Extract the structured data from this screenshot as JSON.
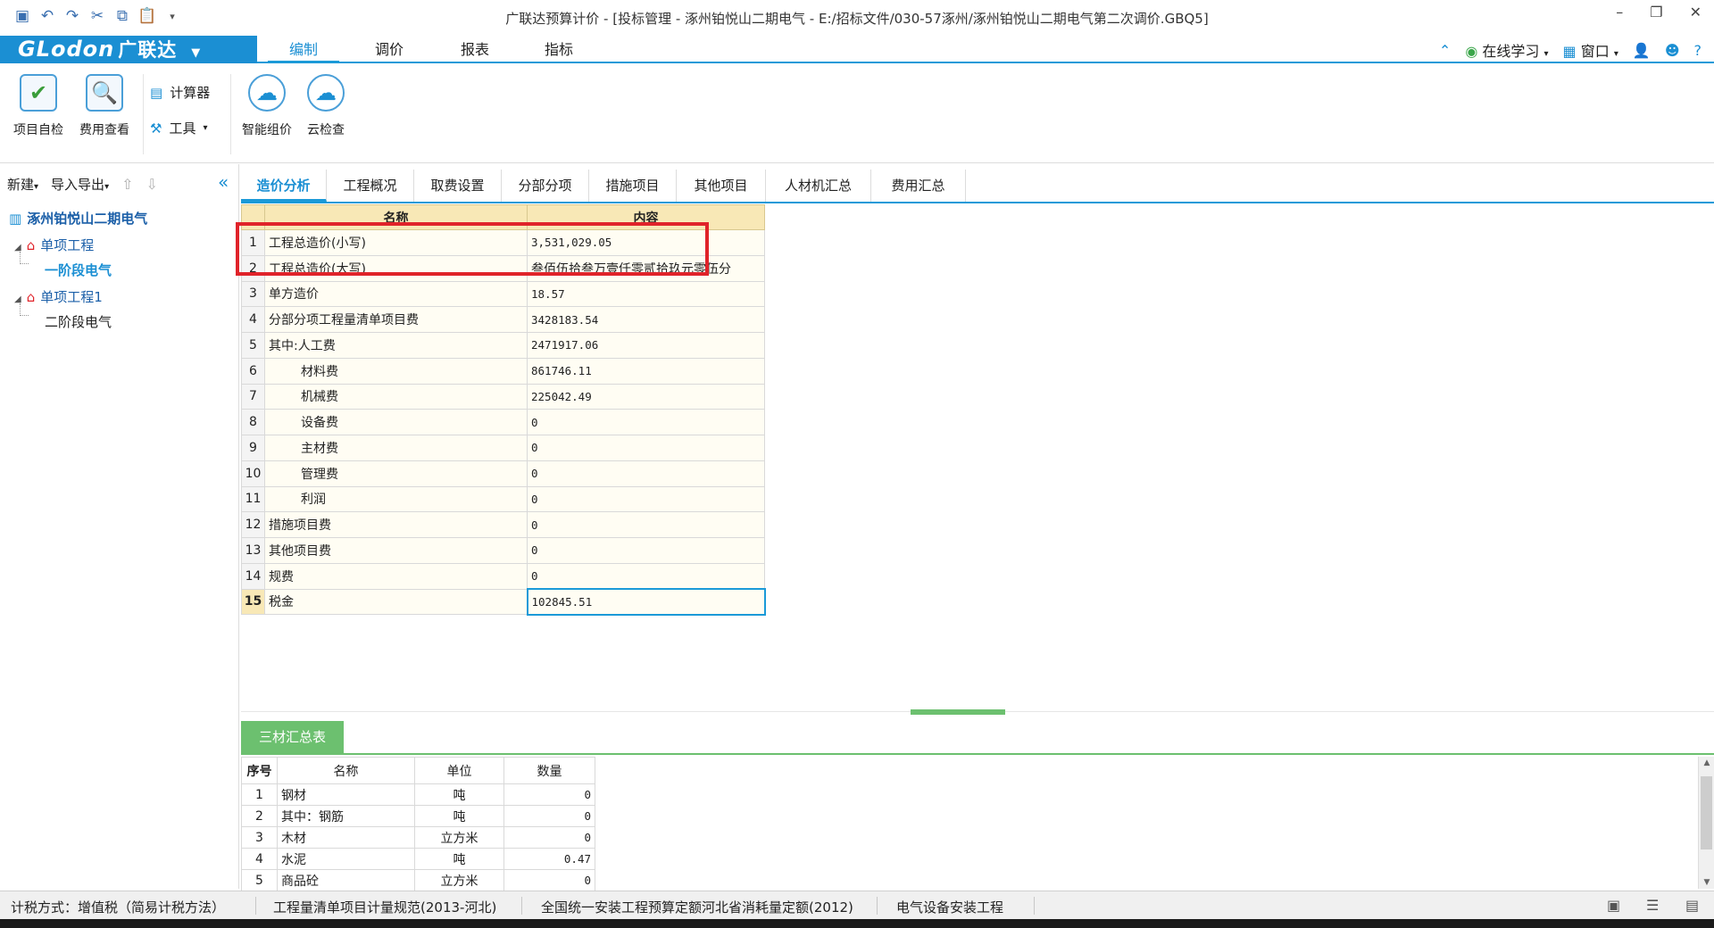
{
  "window": {
    "title": "广联达预算计价 - [投标管理 - 涿州铂悦山二期电气 - E:/招标文件/030-57涿州/涿州铂悦山二期电气第二次调价.GBQ5]"
  },
  "menubar": {
    "logo_text": "GLodon",
    "logo_cn": "广联达",
    "tabs": [
      "编制",
      "调价",
      "报表",
      "指标"
    ],
    "online_learning": "在线学习",
    "window_menu": "窗口",
    "help": "?"
  },
  "ribbon": {
    "project_check": "项目自检",
    "fee_view": "费用查看",
    "calculator": "计算器",
    "tools": "工具",
    "smart_pricing": "智能组价",
    "cloud_check": "云检查"
  },
  "left_panel": {
    "new_label": "新建",
    "import_export_label": "导入导出",
    "project_name": "涿州铂悦山二期电气",
    "tree": [
      {
        "label": "单项工程",
        "children": [
          "一阶段电气"
        ]
      },
      {
        "label": "单项工程1",
        "children": [
          "二阶段电气"
        ]
      }
    ]
  },
  "tabs": [
    "造价分析",
    "工程概况",
    "取费设置",
    "分部分项",
    "措施项目",
    "其他项目",
    "人材机汇总",
    "费用汇总"
  ],
  "cost_table": {
    "headers": [
      "名称",
      "内容"
    ],
    "rows": [
      {
        "no": "1",
        "name": "工程总造价(小写)",
        "value": "3,531,029.05"
      },
      {
        "no": "2",
        "name": "工程总造价(大写)",
        "value": "叁佰伍拾叁万壹仟零贰拾玖元零伍分"
      },
      {
        "no": "3",
        "name": "单方造价",
        "value": "18.57"
      },
      {
        "no": "4",
        "name": "分部分项工程量清单项目费",
        "value": "3428183.54"
      },
      {
        "no": "5",
        "name": "其中:人工费",
        "value": "2471917.06"
      },
      {
        "no": "6",
        "name": "材料费",
        "value": "861746.11"
      },
      {
        "no": "7",
        "name": "机械费",
        "value": "225042.49"
      },
      {
        "no": "8",
        "name": "设备费",
        "value": "0"
      },
      {
        "no": "9",
        "name": "主材费",
        "value": "0"
      },
      {
        "no": "10",
        "name": "管理费",
        "value": "0"
      },
      {
        "no": "11",
        "name": "利润",
        "value": "0"
      },
      {
        "no": "12",
        "name": "措施项目费",
        "value": "0"
      },
      {
        "no": "13",
        "name": "其他项目费",
        "value": "0"
      },
      {
        "no": "14",
        "name": "规费",
        "value": "0"
      },
      {
        "no": "15",
        "name": "税金",
        "value": "102845.51"
      }
    ]
  },
  "materials": {
    "tab_label": "三材汇总表",
    "headers": [
      "序号",
      "名称",
      "单位",
      "数量"
    ],
    "rows": [
      {
        "no": "1",
        "name": "钢材",
        "unit": "吨",
        "qty": "0"
      },
      {
        "no": "2",
        "name": "其中：钢筋",
        "unit": "吨",
        "qty": "0"
      },
      {
        "no": "3",
        "name": "木材",
        "unit": "立方米",
        "qty": "0"
      },
      {
        "no": "4",
        "name": "水泥",
        "unit": "吨",
        "qty": "0.47"
      },
      {
        "no": "5",
        "name": "商品砼",
        "unit": "立方米",
        "qty": "0"
      }
    ]
  },
  "statusbar": {
    "tax_method": "计税方式：增值税（简易计税方法）",
    "spec": "工程量清单项目计量规范(2013-河北)",
    "quota": "全国统一安装工程预算定额河北省消耗量定额(2012)",
    "category": "电气设备安装工程"
  },
  "colors": {
    "brand_blue": "#1b8fd3",
    "highlight_red": "#e0232a",
    "header_gold": "#f8e8b6",
    "green_tab": "#6cc06f"
  }
}
